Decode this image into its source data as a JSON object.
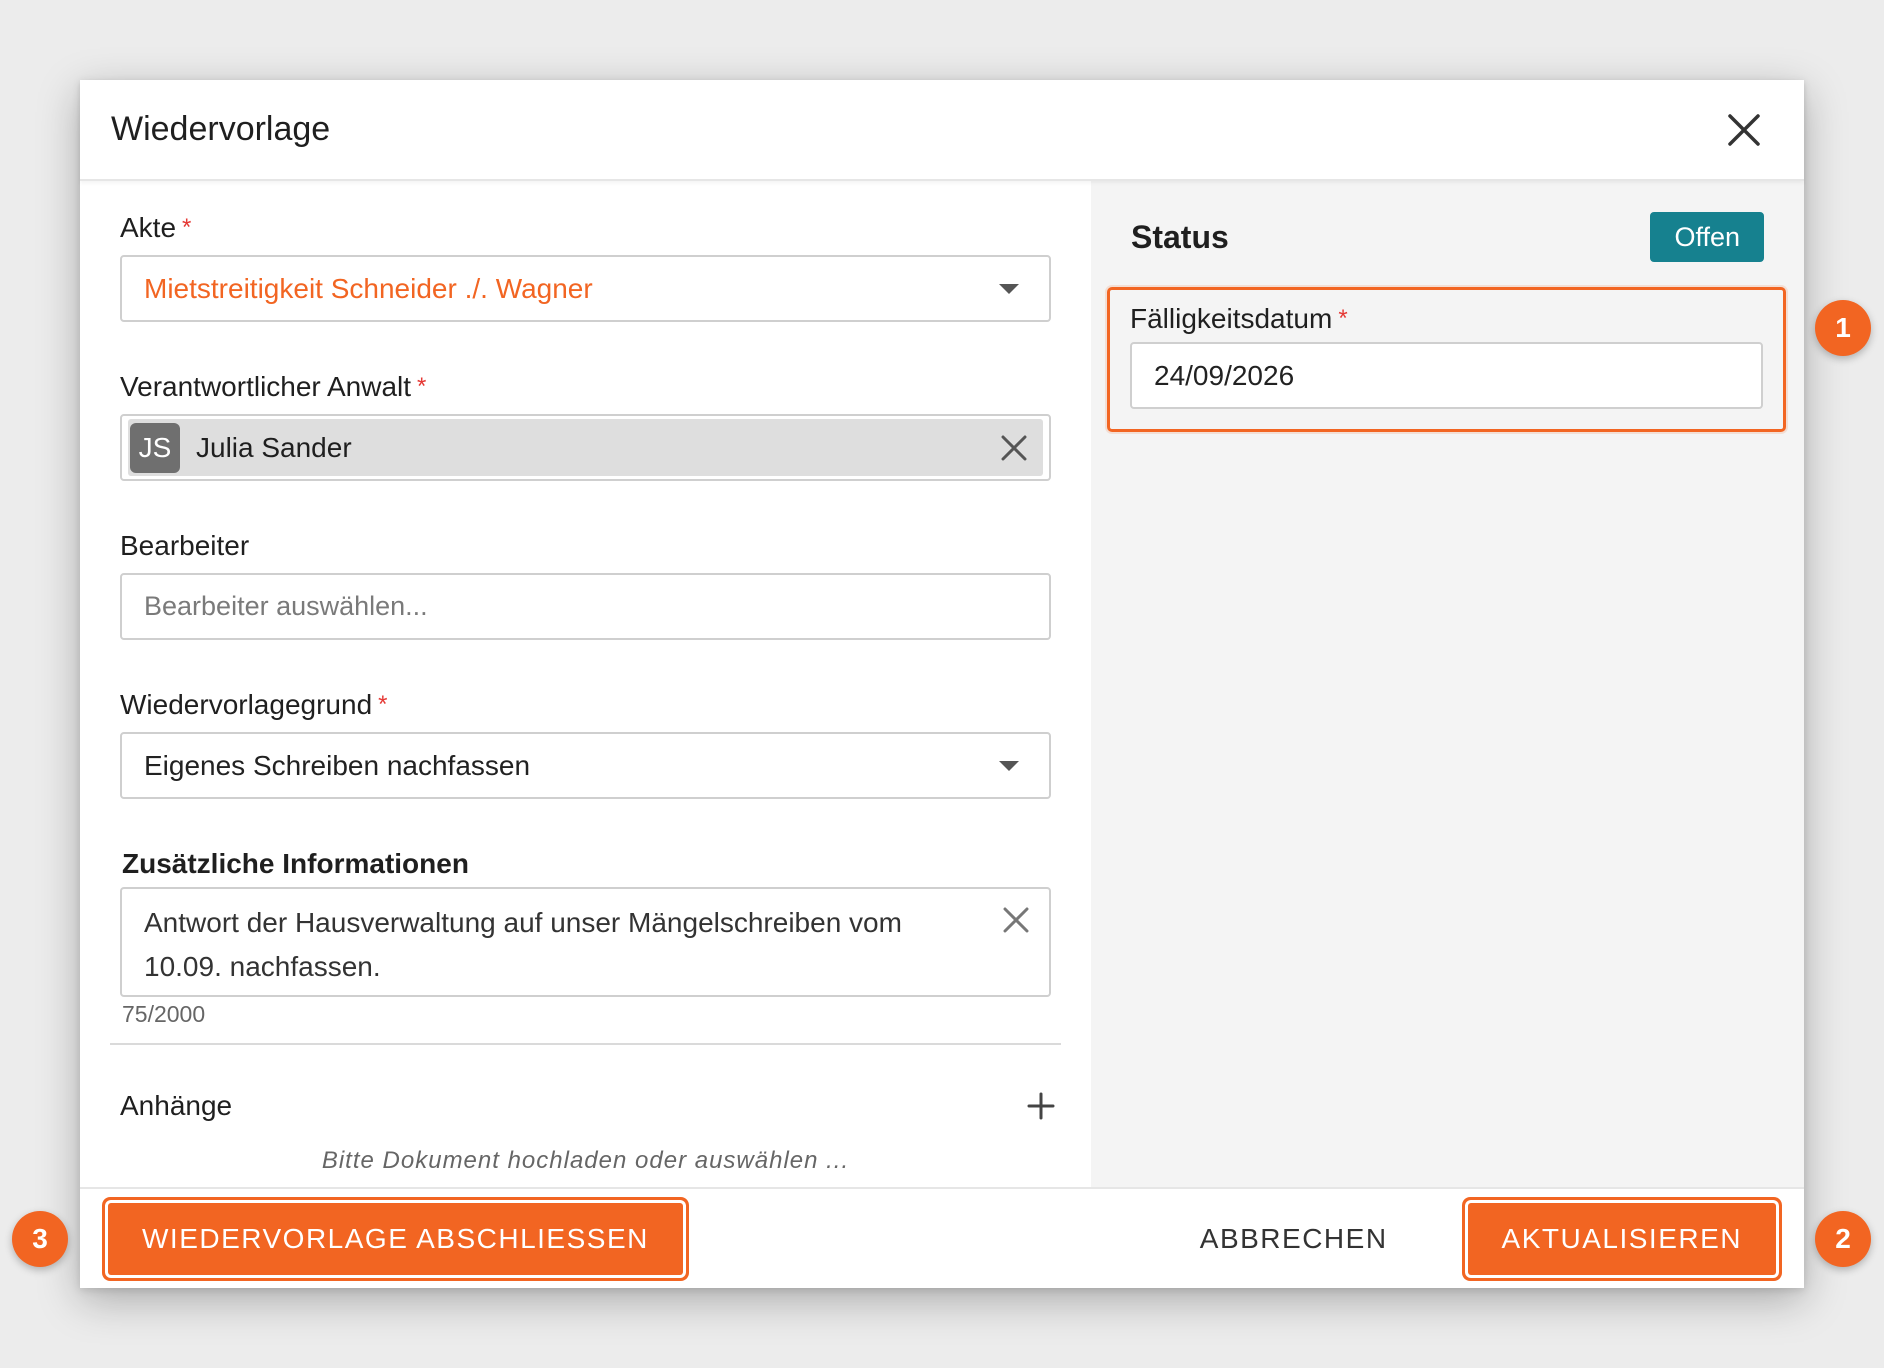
{
  "dialog": {
    "title": "Wiedervorlage"
  },
  "form": {
    "akte": {
      "label": "Akte",
      "required_mark": "*",
      "value": "Mietstreitigkeit Schneider ./. Wagner"
    },
    "anwalt": {
      "label": "Verantwortlicher Anwalt",
      "required_mark": "*",
      "avatar_initials": "JS",
      "value": "Julia Sander"
    },
    "bearbeiter": {
      "label": "Bearbeiter",
      "placeholder": "Bearbeiter auswählen..."
    },
    "grund": {
      "label": "Wiedervorlagegrund",
      "required_mark": "*",
      "value": "Eigenes Schreiben nachfassen"
    },
    "info": {
      "label": "Zusätzliche Informationen",
      "value_line1": "Antwort der Hausverwaltung auf unser Mängelschreiben vom",
      "value_line2": "10.09. nachfassen.",
      "counter": "75/2000"
    },
    "attachments": {
      "label": "Anhänge",
      "hint": "Bitte Dokument hochladen oder auswählen ..."
    }
  },
  "status": {
    "label": "Status",
    "badge": "Offen",
    "due": {
      "label": "Fälligkeitsdatum",
      "required_mark": "*",
      "value": "24/09/2026"
    }
  },
  "footer": {
    "complete_label": "WIEDERVORLAGE ABSCHLIESSEN",
    "cancel_label": "ABBRECHEN",
    "update_label": "AKTUALISIEREN"
  },
  "markers": {
    "one": "1",
    "two": "2",
    "three": "3"
  },
  "colors": {
    "accent": "#f26522",
    "status_badge": "#16818f",
    "required": "#e53935"
  },
  "icons": {
    "close": "close-icon",
    "dropdown": "chevron-down-icon",
    "clear": "clear-icon",
    "add": "plus-icon"
  }
}
